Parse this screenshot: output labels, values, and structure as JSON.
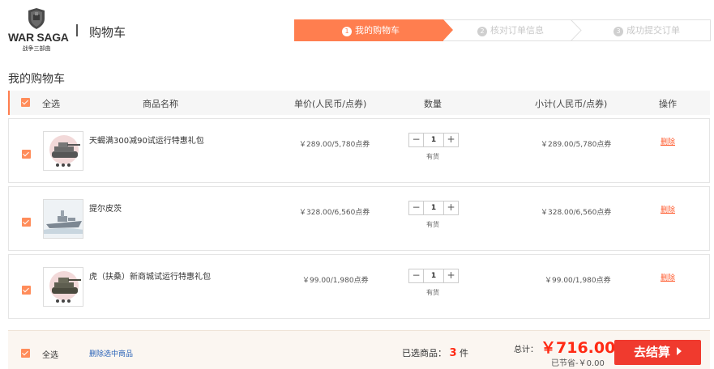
{
  "header": {
    "brand": "WAR SAGA",
    "brand_sub": "战争三部曲",
    "title": "购物车"
  },
  "steps": [
    {
      "num": "1",
      "label": "我的购物车",
      "active": true
    },
    {
      "num": "2",
      "label": "核对订单信息",
      "active": false
    },
    {
      "num": "3",
      "label": "成功提交订单",
      "active": false
    }
  ],
  "section_title": "我的购物车",
  "table_header": {
    "select_all": "全选",
    "name": "商品名称",
    "unit_price": "单价(人民币/点券)",
    "quantity": "数量",
    "subtotal": "小计(人民币/点券)",
    "action": "操作"
  },
  "items": [
    {
      "name": "天蝎满300减90试运行特惠礼包",
      "price": "￥289.00/5,780点券",
      "qty": "1",
      "stock": "有货",
      "subtotal": "￥289.00/5,780点券",
      "delete": "删除",
      "thumb": "tank-icon"
    },
    {
      "name": "提尔皮茨",
      "price": "￥328.00/6,560点券",
      "qty": "1",
      "stock": "有货",
      "subtotal": "￥328.00/6,560点券",
      "delete": "删除",
      "thumb": "battleship-icon"
    },
    {
      "name": "虎（扶桑）新商城试运行特惠礼包",
      "price": "￥99.00/1,980点券",
      "qty": "1",
      "stock": "有货",
      "subtotal": "￥99.00/1,980点券",
      "delete": "删除",
      "thumb": "tank-icon"
    }
  ],
  "footer": {
    "select_all": "全选",
    "delete_selected": "删除选中商品",
    "selected_prefix": "已选商品：",
    "selected_count": "3",
    "selected_suffix": "件",
    "total_label": "总计：",
    "total": "￥716.00",
    "saved": "已节省-￥0.00",
    "checkout": "去结算"
  },
  "colors": {
    "accent": "#ff7e4f",
    "checkout": "#f03a2e",
    "price_red": "#ff2a14",
    "link_blue": "#2a63b8"
  }
}
